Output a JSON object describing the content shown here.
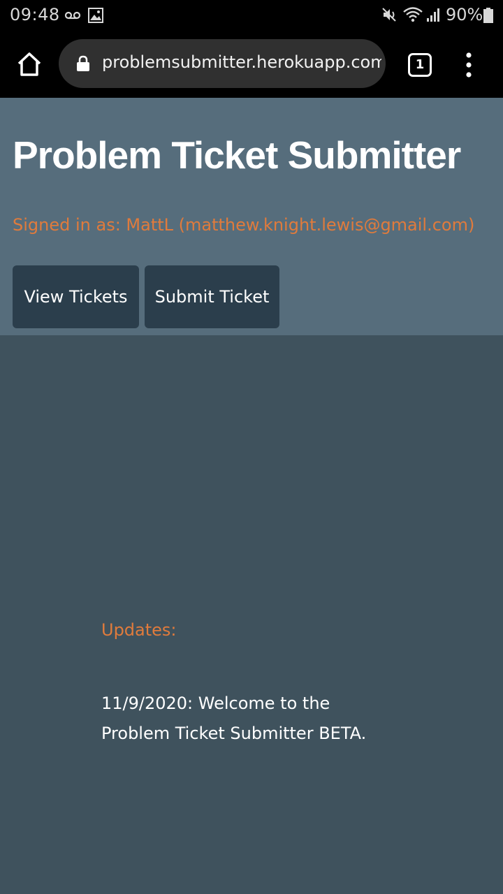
{
  "status_bar": {
    "time": "09:48",
    "battery_percent": "90%",
    "icons": [
      "voicemail-icon",
      "image-icon",
      "mute-icon",
      "wifi-icon",
      "signal-icon",
      "battery-icon"
    ]
  },
  "browser": {
    "url": "problemsubmitter.herokuapp.com/l",
    "tab_count": "1",
    "icons": [
      "home-icon",
      "lock-icon",
      "menu-dots-icon"
    ]
  },
  "header": {
    "title": "Problem Ticket Submitter",
    "signed_in": "Signed in as: MattL (matthew.knight.lewis@gmail.com)"
  },
  "nav": {
    "view_label": "View Tickets",
    "submit_label": "Submit Ticket"
  },
  "updates": {
    "heading": "Updates:",
    "text": "11/9/2020: Welcome to the Problem Ticket Submitter BETA."
  },
  "colors": {
    "header_bg": "#566d7c",
    "page_bg": "#3f525d",
    "button_bg": "#2b3e4c",
    "accent_orange": "#e07b3c"
  }
}
